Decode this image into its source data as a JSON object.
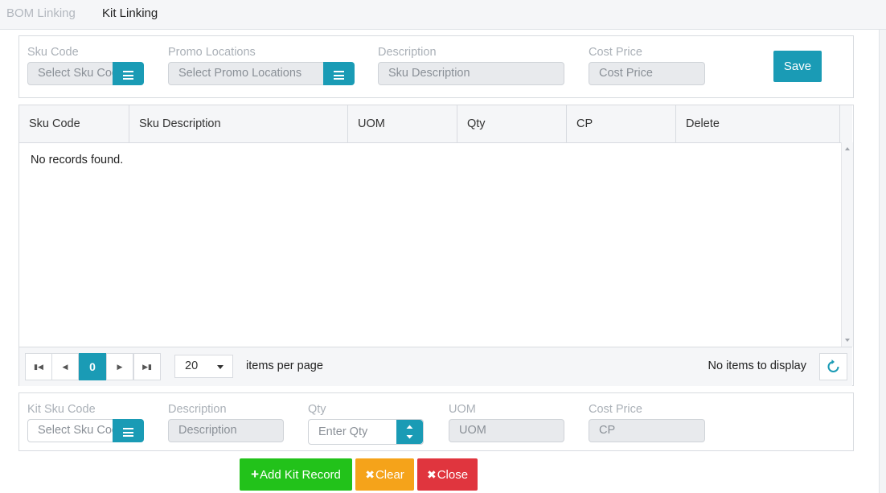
{
  "tabs": {
    "bom": "BOM Linking",
    "kit": "Kit Linking"
  },
  "header_form": {
    "sku_code_label": "Sku Code",
    "sku_code_placeholder": "Select Sku Code",
    "promo_locations_label": "Promo Locations",
    "promo_locations_placeholder": "Select Promo Locations",
    "description_label": "Description",
    "description_placeholder": "Sku Description",
    "cost_price_label": "Cost Price",
    "cost_price_placeholder": "Cost Price",
    "save_label": "Save"
  },
  "grid": {
    "columns": [
      "Sku Code",
      "Sku Description",
      "UOM",
      "Qty",
      "CP",
      "Delete"
    ],
    "empty_message": "No records found."
  },
  "pager": {
    "current_page": "0",
    "page_size": "20",
    "items_per_page_label": "items per page",
    "status": "No items to display"
  },
  "kit_form": {
    "kit_sku_code_label": "Kit Sku Code",
    "kit_sku_code_placeholder": "Select Sku Code",
    "description_label": "Description",
    "description_placeholder": "Description",
    "qty_label": "Qty",
    "qty_placeholder": "Enter Qty",
    "uom_label": "UOM",
    "uom_placeholder": "UOM",
    "cost_price_label": "Cost Price",
    "cost_price_placeholder": "CP"
  },
  "actions": {
    "add": "Add Kit Record",
    "clear": "Clear",
    "close": "Close"
  },
  "colors": {
    "accent": "#1a9bb5",
    "add": "#22c21a",
    "clear": "#f5a31a",
    "close": "#e0353e"
  }
}
